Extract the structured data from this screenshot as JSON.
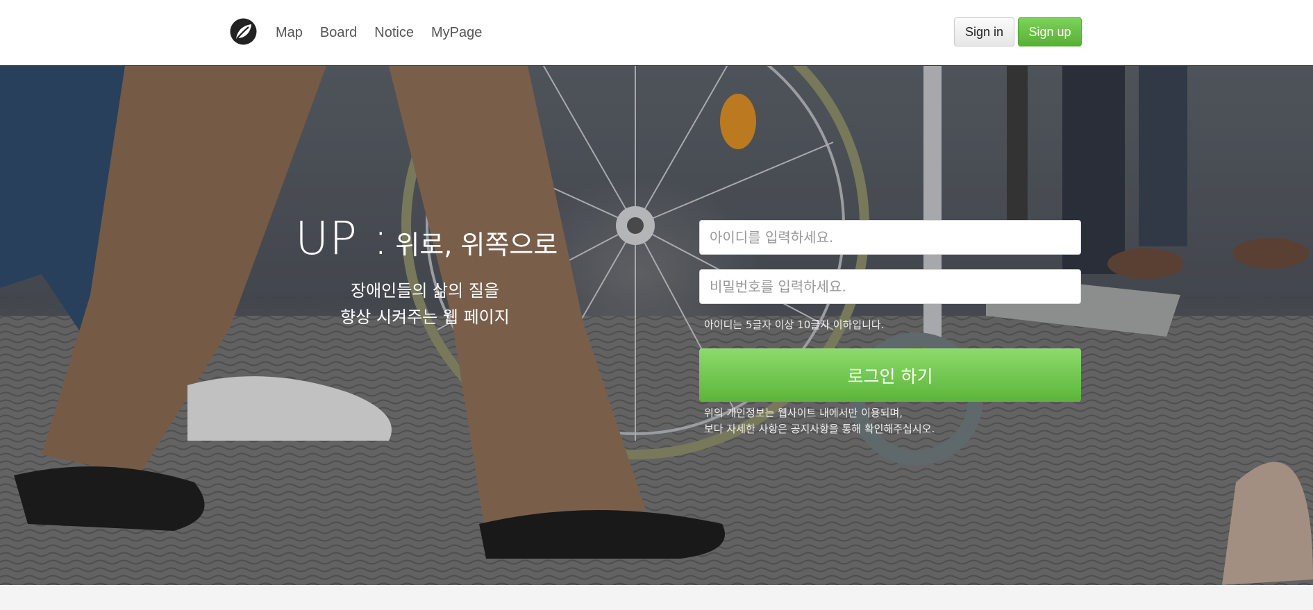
{
  "nav": {
    "logo_icon": "leaf-icon",
    "links": [
      "Map",
      "Board",
      "Notice",
      "MyPage"
    ],
    "signin_label": "Sign in",
    "signup_label": "Sign up",
    "signup_color": "#5cb85c"
  },
  "hero": {
    "title_big": "UP :",
    "title_sub": "위로, 위쪽으로",
    "desc_line1": "장애인들의 삶의 질을",
    "desc_line2": "향상 시켜주는 웹 페이지",
    "id_placeholder": "아이디를 입력하세요.",
    "pw_placeholder": "비밀번호를 입력하세요.",
    "hint": "아이디는 5글자 이상 10글자 이하입니다.",
    "login_label": "로그인 하기",
    "notice_line1": "위의 개인정보는 웹사이트 내에서만 이용되며,",
    "notice_line2": "보다 자세한 사항은 공지사항을 통해 확인해주십시오."
  }
}
